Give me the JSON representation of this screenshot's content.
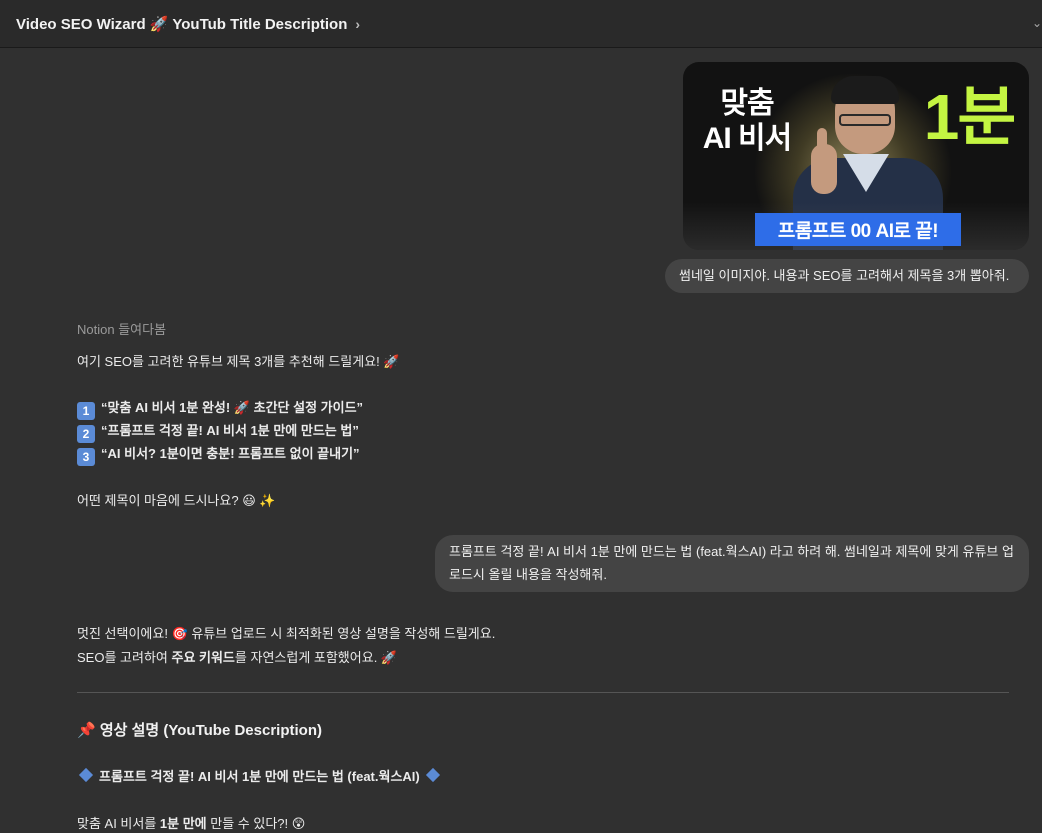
{
  "header": {
    "title": "Video SEO Wizard 🚀 YouTub Title Description",
    "chevron": "›",
    "right_glyph": "⌄"
  },
  "thumbnail": {
    "text_left_line1": "맞춤",
    "text_left_line2": "AI 비서",
    "text_right": "1분",
    "banner": "프롬프트 00 AI로 끝!"
  },
  "messages": {
    "user1": "썸네일 이미지야. 내용과 SEO를 고려해서 제목을 3개 뽑아줘.",
    "source_label": "Notion 들여다봄",
    "assistant1_intro": "여기 SEO를 고려한 유튜브 제목 3개를 추천해 드릴게요! 🚀",
    "titles": [
      {
        "num": "1",
        "text": "“맞춤 AI 비서 1분 완성! 🚀 초간단 설정 가이드”"
      },
      {
        "num": "2",
        "text": "“프롬프트 걱정 끝! AI 비서 1분 만에 만드는 법”"
      },
      {
        "num": "3",
        "text": "“AI 비서? 1분이면 충분! 프롬프트 없이 끝내기”"
      }
    ],
    "assistant1_outro": "어떤 제목이 마음에 드시나요? 😃 ✨",
    "user2": "프롬프트 걱정 끝! AI 비서 1분 만에 만드는 법 (feat.웍스AI) 라고 하려 해. 썸네일과 제목에 맞게 유튜브 업로드시 올릴 내용을 작성해줘.",
    "assistant2_line1": "멋진 선택이에요! 🎯 유튜브 업로드 시 최적화된 영상 설명을 작성해 드릴게요.",
    "assistant2_line2_a": "SEO를 고려하여 ",
    "assistant2_line2_b": "주요 키워드",
    "assistant2_line2_c": "를 자연스럽게 포함했어요. 🚀",
    "section_heading": "📌 영상 설명 (YouTube Description)",
    "video_title": "프롬프트 걱정 끝! AI 비서 1분 만에 만드는 법 (feat.웍스AI)",
    "last_line_a": "맞춤 AI 비서를 ",
    "last_line_b": "1분 만에",
    "last_line_c": " 만들 수 있다?! 😲"
  }
}
